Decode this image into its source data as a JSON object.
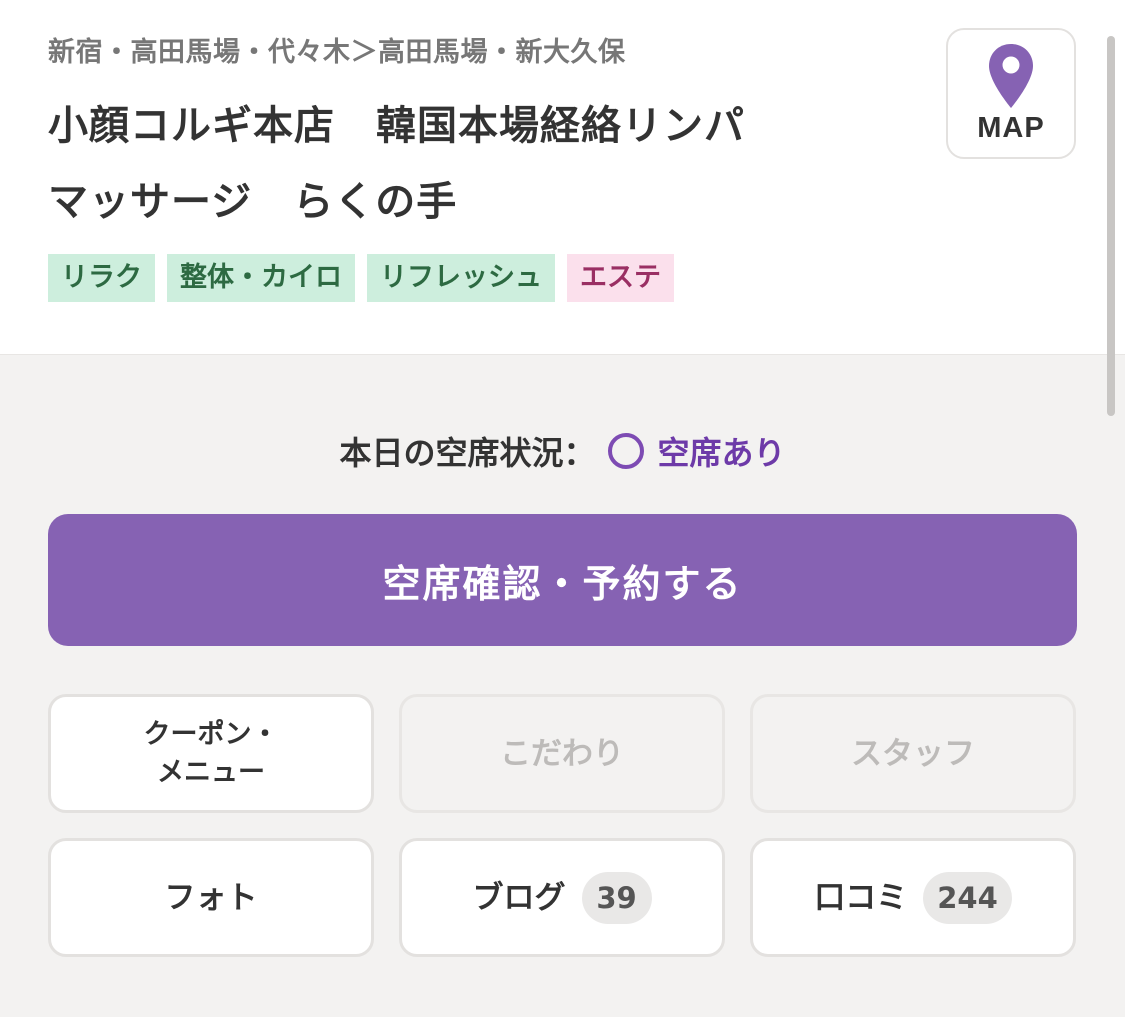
{
  "header": {
    "breadcrumb": "新宿・高田馬場・代々木＞高田馬場・新大久保",
    "shop_name_line1": "小顔コルギ本店　韓国本場経絡リンパ",
    "shop_name_line2": "マッサージ　らくの手",
    "tags": [
      {
        "label": "リラク",
        "color": "#cdeedd"
      },
      {
        "label": "整体・カイロ",
        "color": "#cdeedd"
      },
      {
        "label": "リフレッシュ",
        "color": "#cdeedd"
      },
      {
        "label": "エステ",
        "color": "#fbe0ec"
      }
    ],
    "map_button": {
      "label": "MAP",
      "icon": "map-pin-icon",
      "color": "#8662b3"
    }
  },
  "availability": {
    "label": "本日の空席状況：",
    "icon": "circle-icon",
    "status": "空席あり"
  },
  "reserve_button": {
    "label": "空席確認・予約する",
    "color": "#8662b3"
  },
  "nav": {
    "coupon_menu": {
      "line1": "クーポン・",
      "line2": "メニュー"
    },
    "kodawari": {
      "label": "こだわり"
    },
    "staff": {
      "label": "スタッフ"
    },
    "photo": {
      "label": "フォト"
    },
    "blog": {
      "label": "ブログ",
      "count": "39"
    },
    "reviews": {
      "label": "口コミ",
      "count": "244"
    }
  }
}
